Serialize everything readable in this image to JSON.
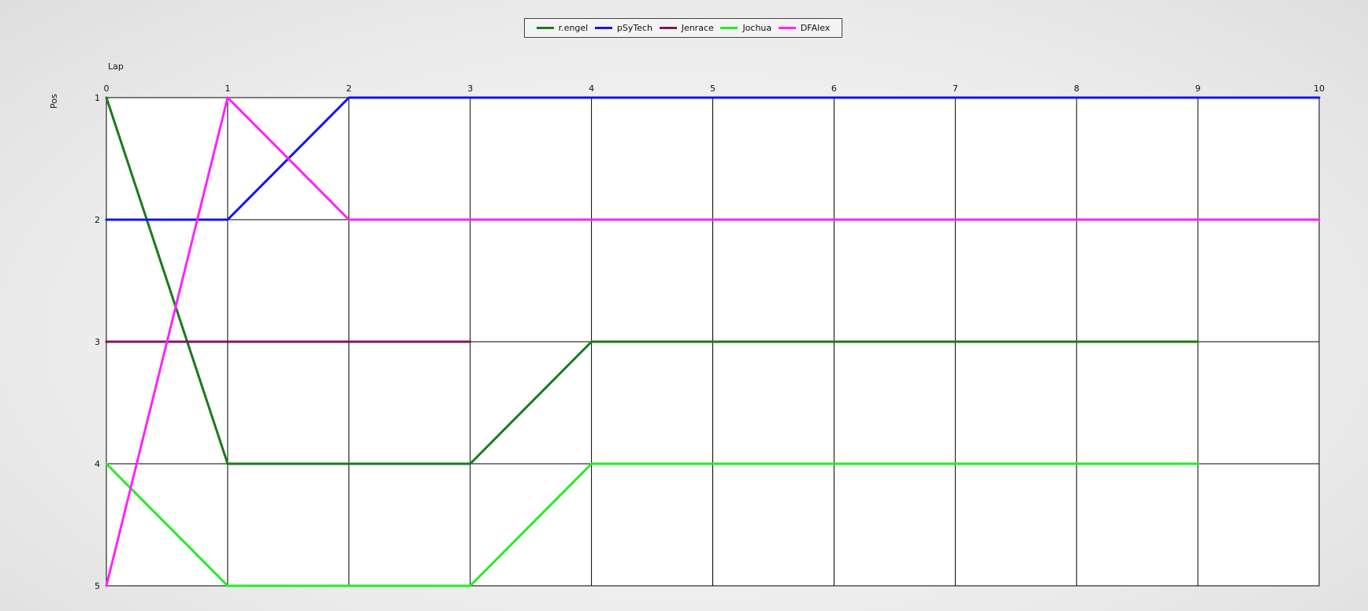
{
  "chart_data": {
    "type": "line",
    "xlabel": "Lap",
    "ylabel": "Pos",
    "x": [
      0,
      1,
      2,
      3,
      4,
      5,
      6,
      7,
      8,
      9,
      10
    ],
    "xlim": [
      0,
      10
    ],
    "ylim": [
      1,
      5
    ],
    "y_inverted": true,
    "y_ticks": [
      1,
      2,
      3,
      4,
      5
    ],
    "grid": true,
    "legend_position": "top-center",
    "series": [
      {
        "name": "r.engel",
        "color": "#1a7a1a",
        "points": [
          [
            0,
            1
          ],
          [
            1,
            4
          ],
          [
            2,
            4
          ],
          [
            3,
            4
          ],
          [
            4,
            3
          ],
          [
            5,
            3
          ],
          [
            6,
            3
          ],
          [
            7,
            3
          ],
          [
            8,
            3
          ],
          [
            9,
            3
          ]
        ]
      },
      {
        "name": "pSyTech",
        "color": "#1414f0",
        "points": [
          [
            0,
            2
          ],
          [
            1,
            2
          ],
          [
            2,
            1
          ],
          [
            3,
            1
          ],
          [
            4,
            1
          ],
          [
            5,
            1
          ],
          [
            6,
            1
          ],
          [
            7,
            1
          ],
          [
            8,
            1
          ],
          [
            9,
            1
          ],
          [
            10,
            1
          ]
        ]
      },
      {
        "name": "Jenrace",
        "color": "#7a1a5a",
        "points": [
          [
            0,
            3
          ],
          [
            1,
            3
          ],
          [
            2,
            3
          ],
          [
            3,
            3
          ]
        ]
      },
      {
        "name": "Jochua",
        "color": "#22ee22",
        "points": [
          [
            0,
            4
          ],
          [
            1,
            5
          ],
          [
            2,
            5
          ],
          [
            3,
            5
          ],
          [
            4,
            4
          ],
          [
            5,
            4
          ],
          [
            6,
            4
          ],
          [
            7,
            4
          ],
          [
            8,
            4
          ],
          [
            9,
            4
          ]
        ]
      },
      {
        "name": "DFAlex",
        "color": "#ff22ff",
        "points": [
          [
            0,
            5
          ],
          [
            1,
            1
          ],
          [
            2,
            2
          ],
          [
            3,
            2
          ],
          [
            4,
            2
          ],
          [
            5,
            2
          ],
          [
            6,
            2
          ],
          [
            7,
            2
          ],
          [
            8,
            2
          ],
          [
            9,
            2
          ],
          [
            10,
            2
          ]
        ]
      }
    ]
  }
}
